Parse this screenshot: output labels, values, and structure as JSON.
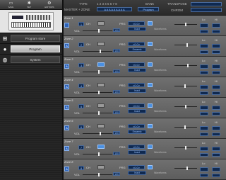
{
  "toolbar": {
    "items": [
      {
        "label": "SAVE",
        "icon": "disk-icon"
      },
      {
        "label": "SET",
        "icon": "gear-icon"
      },
      {
        "label": "EDITORS",
        "icon": "editors-icon"
      }
    ]
  },
  "nav": {
    "items": [
      {
        "label": "Program store",
        "icon": "grid-icon",
        "active": false
      },
      {
        "label": "Program",
        "icon": "circle-icon",
        "active": true
      },
      {
        "label": "System",
        "icon": "globe-icon",
        "active": false
      }
    ]
  },
  "header": {
    "type_label": "TYPE",
    "master_label": "MASTER + ZONE",
    "zone_numbers": "1 2 3 4 5 6 7 8",
    "zone_states": "A A A A A A A A A",
    "bank_label": "BANK",
    "bank_value": "Program",
    "transpose_label": "TRANSPOSE",
    "chrom_label": "CHROM",
    "chrom_value": ""
  },
  "zones": [
    {
      "title": "Zone 1",
      "lock": "",
      "ch": "1",
      "ch_label": "CH",
      "prg": "<0.0>",
      "pname": "Inact",
      "vol": "100",
      "vol_pos": 0.55,
      "range": 0.5,
      "lo": "",
      "hi": "",
      "active": false
    },
    {
      "title": "Zone 2",
      "lock": "A",
      "ch": "2",
      "ch_label": "CH",
      "prg": "<0.0>",
      "pname": "Ensemb",
      "vol": "100",
      "vol_pos": 0.6,
      "range": 0.55,
      "lo": "",
      "hi": "",
      "active": false
    },
    {
      "title": "Zone 3",
      "lock": "A",
      "ch": "3",
      "ch_label": "CH",
      "prg": "<0.0>",
      "pname": "Inact",
      "vol": "100",
      "vol_pos": 0.55,
      "range": 0.6,
      "lo": "",
      "hi": "",
      "active": true
    },
    {
      "title": "Zone 4",
      "lock": "A",
      "ch": "4",
      "ch_label": "CH",
      "prg": "<0.0>",
      "pname": "Inact",
      "vol": "100",
      "vol_pos": 0.55,
      "range": 0.45,
      "lo": "",
      "hi": "",
      "active": false
    },
    {
      "title": "Zone 5",
      "lock": "A",
      "ch": "5",
      "ch_label": "CH",
      "prg": "<0.0>",
      "pname": "Inact",
      "vol": "100",
      "vol_pos": 0.55,
      "range": 0.5,
      "lo": "",
      "hi": "",
      "active": false
    },
    {
      "title": "Zone 6",
      "lock": "A",
      "ch": "6",
      "ch_label": "CH",
      "prg": "<0.0>",
      "pname": "Ensemb",
      "vol": "100",
      "vol_pos": 0.6,
      "range": 0.45,
      "lo": "",
      "hi": "",
      "active": false
    },
    {
      "title": "Zone 7",
      "lock": "A",
      "ch": "7",
      "ch_label": "CH",
      "prg": "<0.0>",
      "pname": "Inact",
      "vol": "100",
      "vol_pos": 0.55,
      "range": 0.5,
      "lo": "",
      "hi": "",
      "active": true
    },
    {
      "title": "Zone 8",
      "lock": "A",
      "ch": "8",
      "ch_label": "CH",
      "prg": "<0.0>",
      "pname": "Inact",
      "vol": "100",
      "vol_pos": 0.55,
      "range": 0.55,
      "lo": "",
      "hi": "",
      "active": false
    }
  ],
  "labels": {
    "prg": "PRG",
    "vol": "VOL",
    "lo": "Lo",
    "hi": "Hi",
    "wave": "Waveforms"
  }
}
